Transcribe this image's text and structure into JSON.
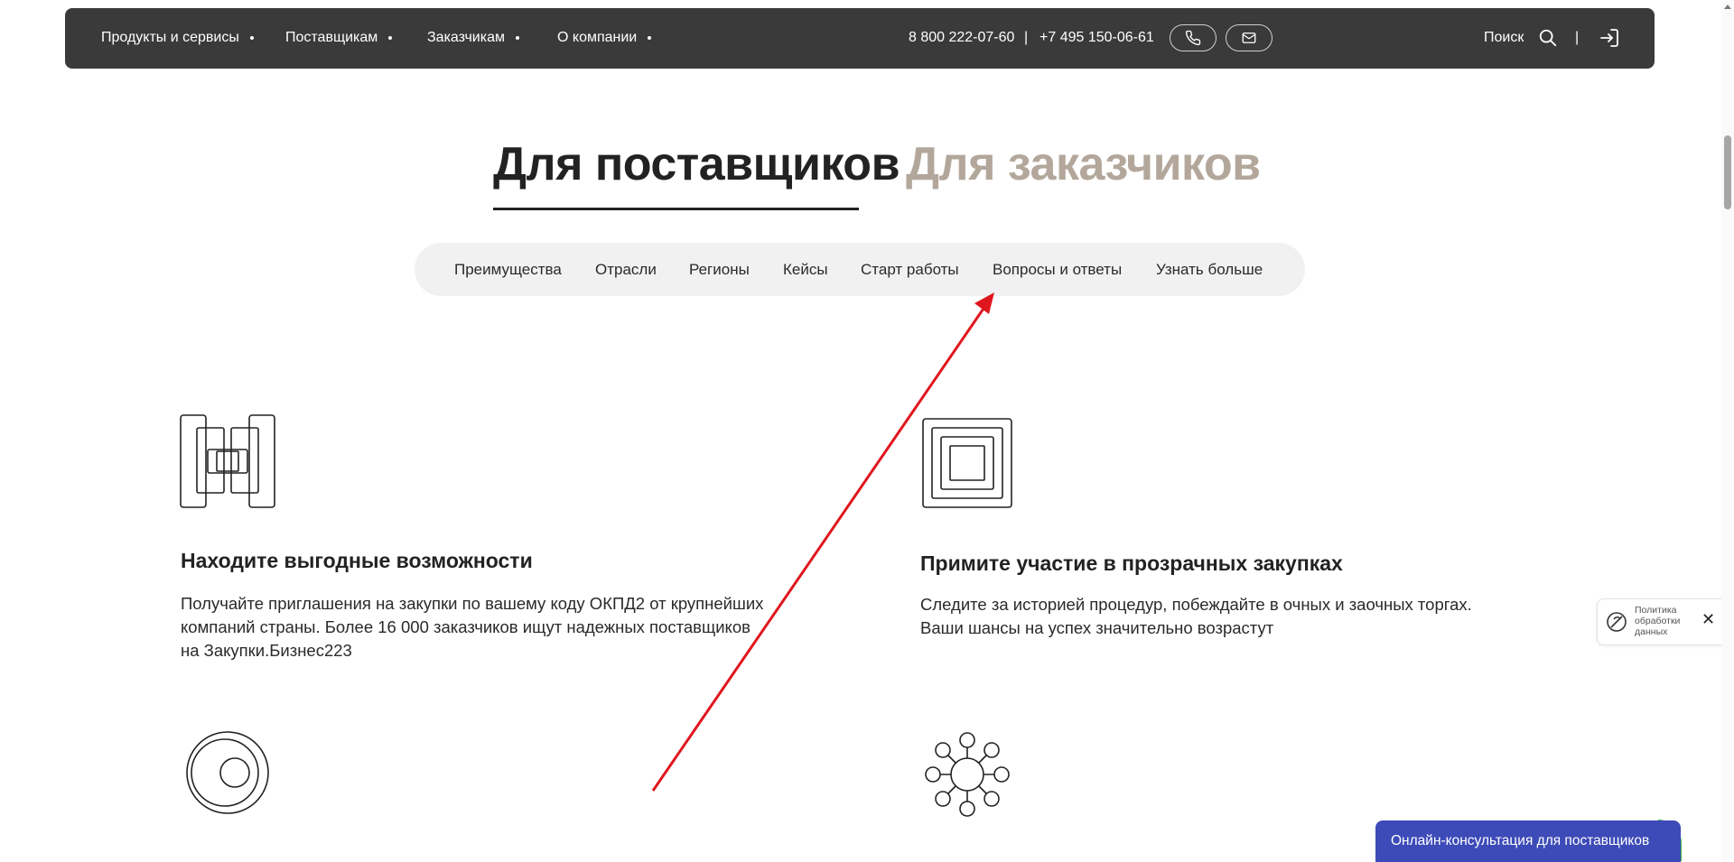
{
  "nav": {
    "items": [
      {
        "label": "Продукты и сервисы"
      },
      {
        "label": "Поставщикам"
      },
      {
        "label": "Заказчикам"
      },
      {
        "label": "О компании"
      }
    ],
    "phone1": "8 800 222-07-60",
    "separator": "|",
    "phone2": "+7 495 150-06-61",
    "search_label": "Поиск",
    "divider": "|",
    "icons": {
      "phone": "phone-icon",
      "mail": "mail-icon",
      "search": "search-icon",
      "login": "login-icon"
    }
  },
  "audience_tabs": {
    "suppliers": "Для поставщиков",
    "customers": "Для заказчиков",
    "active": "suppliers"
  },
  "section_nav": {
    "items": [
      {
        "label": "Преимущества"
      },
      {
        "label": "Отрасли"
      },
      {
        "label": "Регионы"
      },
      {
        "label": "Кейсы"
      },
      {
        "label": "Старт работы"
      },
      {
        "label": "Вопросы и ответы"
      },
      {
        "label": "Узнать больше"
      }
    ]
  },
  "features": [
    {
      "icon": "nested-rectangles-icon",
      "title": "Находите выгодные возможности",
      "lines": [
        "Получайте приглашения на закупки по вашему коду ОКПД2 от крупнейших",
        "компаний страны. Более 16 000 заказчиков ищут надежных поставщиков",
        "на Закупки.Бизнес223"
      ]
    },
    {
      "icon": "concentric-squares-icon",
      "title": "Примите участие в прозрачных закупках",
      "lines": [
        "Следите за историей процедур, побеждайте в очных и заочных торгах.",
        "Ваши шансы на успех значительно возрастут"
      ]
    },
    {
      "icon": "concentric-circles-icon"
    },
    {
      "icon": "network-nodes-icon"
    }
  ],
  "policy_widget": {
    "lines": [
      "Политика",
      "обработки",
      "данных"
    ],
    "close": "✕"
  },
  "consultation": {
    "label": "Онлайн-консультация для поставщиков"
  },
  "colors": {
    "topbar": "#3a3a3a",
    "active_tab": "#222222",
    "inactive_tab": "#b3a79b",
    "section_nav_bg": "#f1f1f1",
    "consult_bg": "#3d4bb8",
    "consult_corner": "#3ab54a",
    "annotation_arrow": "#e0161e"
  }
}
